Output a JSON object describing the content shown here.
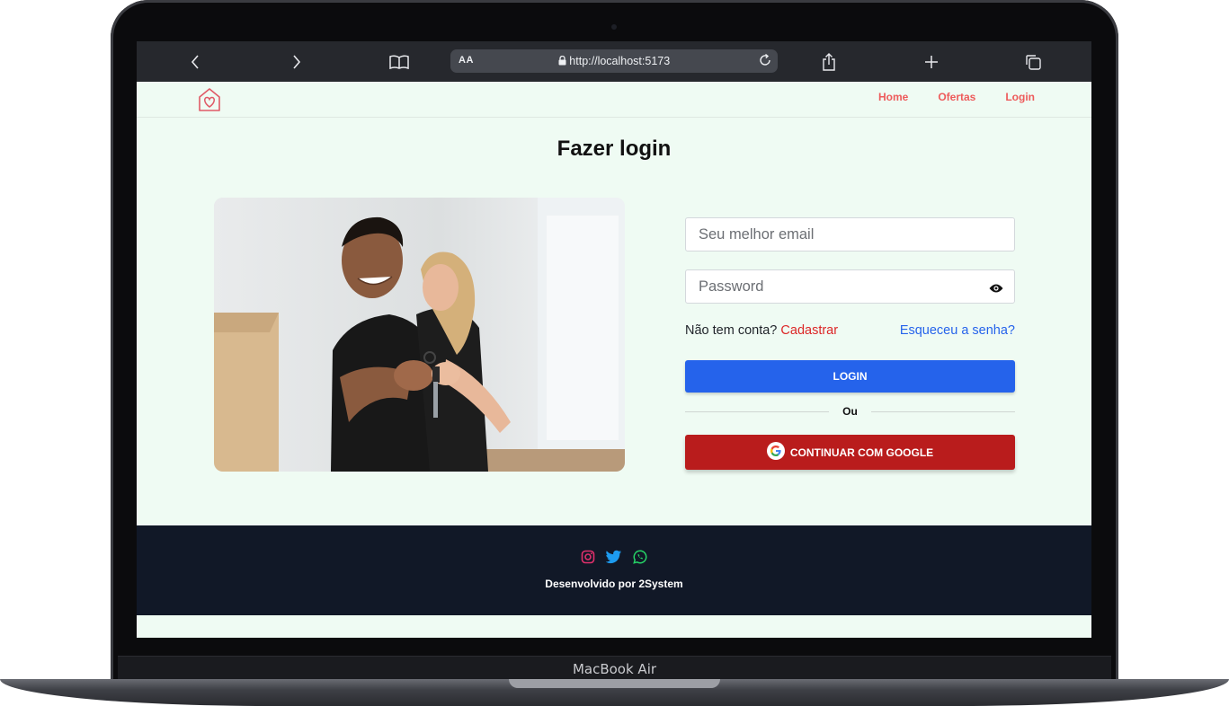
{
  "device": {
    "model_label": "MacBook Air"
  },
  "browser": {
    "text_size_label": "AA",
    "url": "http://localhost:5173",
    "icons": [
      "back-icon",
      "forward-icon",
      "bookmarks-icon",
      "lock-icon",
      "reload-icon",
      "share-icon",
      "new-tab-icon",
      "tabs-icon"
    ]
  },
  "nav": {
    "logo_icon": "house-heart-icon",
    "links": [
      "Home",
      "Ofertas",
      "Login"
    ],
    "link_color": "#ee5b5b"
  },
  "page": {
    "title": "Fazer login"
  },
  "form": {
    "email_placeholder": "Seu melhor email",
    "password_placeholder": "Password",
    "no_account_label": "Não tem conta?",
    "register_link": "Cadastrar",
    "forgot_link": "Esqueceu a senha?",
    "login_button": "LOGIN",
    "divider_text": "Ou",
    "google_button": "CONTINUAR COM GOOGLE"
  },
  "footer": {
    "social_icons": [
      "instagram-icon",
      "twitter-icon",
      "whatsapp-icon"
    ],
    "credit": "Desenvolvido por 2System"
  },
  "colors": {
    "page_bg": "#effbf3",
    "primary": "#2563eb",
    "google_red": "#b91c1c",
    "footer_bg": "#111827"
  }
}
